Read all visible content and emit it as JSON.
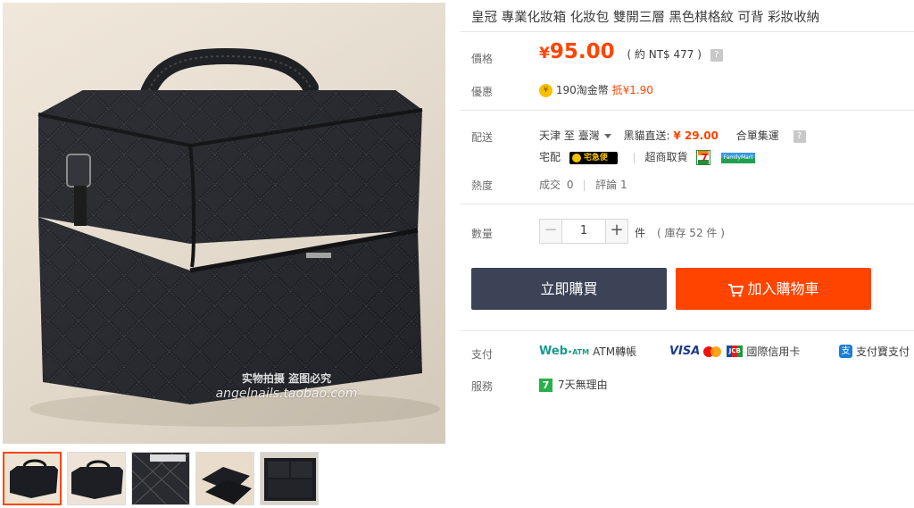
{
  "gallery": {
    "watermark_line1": "实物拍摄 盗图必究",
    "watermark_line2": "angelnails.taobao.com",
    "thumbnail_count": 5,
    "active_thumbnail": 1
  },
  "product": {
    "title": "皇冠 專業化妝箱 化妝包 雙開三層 黑色棋格紋 可背 彩妝收納"
  },
  "price": {
    "label": "價格",
    "currency_symbol": "¥",
    "amount": "95.00",
    "approx": "( 約 NT$ 477 )",
    "help_icon": "?"
  },
  "promo": {
    "label": "優惠",
    "coin_text": "190淘金幣",
    "deduct_tag": "抵",
    "deduct_amount": "¥1.90"
  },
  "shipping": {
    "label": "配送",
    "from": "天津",
    "to_word": "至",
    "destination": "臺灣",
    "direct_label": "黑貓直送:",
    "direct_price": "¥ 29.00",
    "consolidate": "合單集運",
    "help_icon": "?",
    "home_delivery": "宅配",
    "kuro_text": "宅急便",
    "store_pickup": "超商取貨",
    "seven_text": "7",
    "familymart_text": "FamilyMart"
  },
  "popularity": {
    "label": "熱度",
    "deals_label": "成交",
    "deals_value": "0",
    "reviews_label": "評論",
    "reviews_value": "1"
  },
  "quantity": {
    "label": "數量",
    "minus": "−",
    "value": "1",
    "plus": "+",
    "unit": "件",
    "stock": "( 庫存 52 件 )"
  },
  "actions": {
    "buy_now": "立即購買",
    "add_to_cart": "加入購物車"
  },
  "payment": {
    "label": "支付",
    "webatm": "Web",
    "webatm_small": "•ATM",
    "atm_transfer": "ATM轉帳",
    "visa": "VISA",
    "jcb": "JCB",
    "credit_card": "國際信用卡",
    "alipay_icon": "支",
    "alipay": "支付寶支付"
  },
  "service": {
    "label": "服務",
    "badge": "7",
    "text": "7天無理由"
  },
  "colors": {
    "accent": "#ff4400",
    "dark_button": "#3c4356"
  }
}
